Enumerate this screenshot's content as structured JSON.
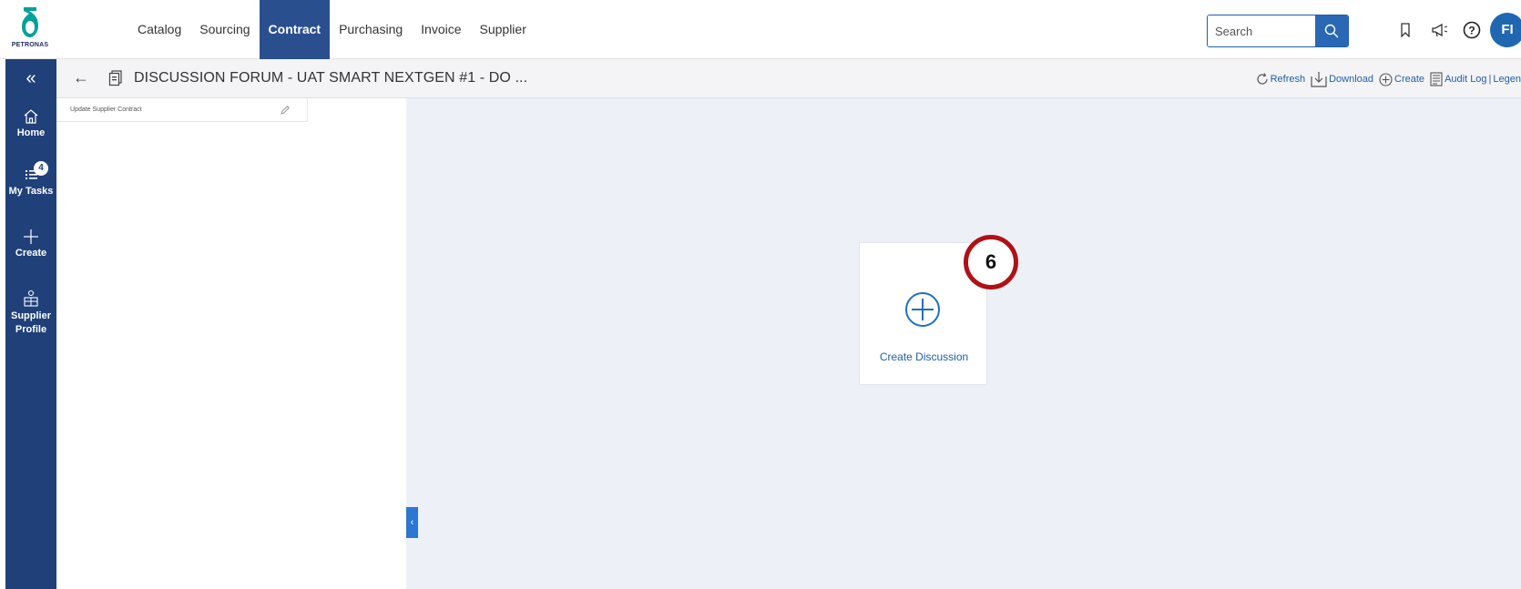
{
  "logo": {
    "text": "PETRONAS",
    "color": "#00a19c"
  },
  "nav": {
    "items": [
      {
        "label": "Catalog"
      },
      {
        "label": "Sourcing"
      },
      {
        "label": "Contract",
        "active": true
      },
      {
        "label": "Purchasing"
      },
      {
        "label": "Invoice"
      },
      {
        "label": "Supplier"
      }
    ]
  },
  "search": {
    "placeholder": "Search",
    "icon": "search-icon"
  },
  "top_icons": [
    "bookmark-icon",
    "announcement-icon",
    "help-icon"
  ],
  "user": {
    "initials": "FI"
  },
  "sidebar": {
    "collapse_icon": "«",
    "items": [
      {
        "label": "Home",
        "icon": "home-icon"
      },
      {
        "label": "My Tasks",
        "icon": "tasks-icon",
        "badge": "4"
      },
      {
        "label": "Create",
        "icon": "plus-icon"
      },
      {
        "label": "Supplier",
        "label2": "Profile",
        "icon": "supplier-profile-icon"
      }
    ]
  },
  "header": {
    "title": "DISCUSSION FORUM - UAT SMART NEXTGEN #1 - DO ...",
    "actions": {
      "refresh": "Refresh",
      "download": "Download",
      "create": "Create",
      "audit_log": "Audit Log",
      "separator": "|",
      "legend": "Legen"
    }
  },
  "left_panel": {
    "contract_label": "Update Supplier Contract"
  },
  "main": {
    "create_discussion_label": "Create Discussion",
    "step_marker": "6",
    "collapse_tab_icon": "‹"
  },
  "colors": {
    "nav_active": "#2a4f8f",
    "sidebar": "#20407a",
    "accent": "#1f5fa8",
    "canvas": "#edf0f7",
    "marker": "#b01116"
  }
}
